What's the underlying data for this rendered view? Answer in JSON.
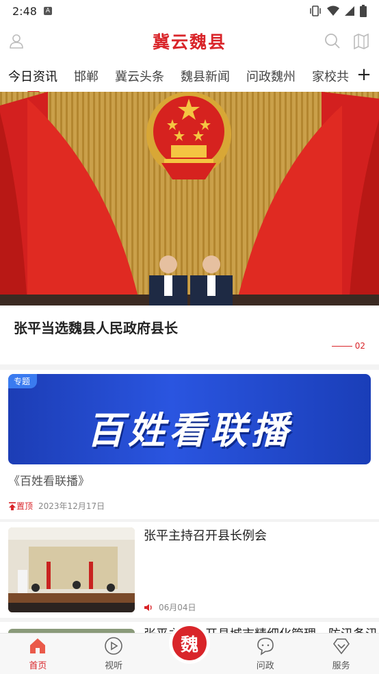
{
  "status_bar": {
    "time": "2:48",
    "a_badge": "A"
  },
  "header": {
    "title": "冀云魏县"
  },
  "tabs": [
    {
      "label": "今日资讯",
      "active": true
    },
    {
      "label": "邯郸"
    },
    {
      "label": "冀云头条"
    },
    {
      "label": "魏县新闻"
    },
    {
      "label": "问政魏州"
    },
    {
      "label": "家校共"
    }
  ],
  "tab_add": "+",
  "hero": {
    "caption": "张平当选魏县人民政府县长",
    "page_indicator": "02"
  },
  "topic": {
    "tag": "专题",
    "banner_text": "百姓看联播",
    "title": "《百姓看联播》",
    "pin_label": "置顶",
    "date": "2023年12月17日"
  },
  "news": [
    {
      "title": "张平主持召开县长例会",
      "date": "06月04日"
    },
    {
      "title": "张平主持召开县城市精细化管理、防汛备汛"
    }
  ],
  "bottom_nav": {
    "home": "首页",
    "video": "视听",
    "center": "魏",
    "wenzheng": "问政",
    "service": "服务"
  },
  "colors": {
    "brand_red": "#d9252a",
    "banner_blue": "#2a55e0"
  }
}
